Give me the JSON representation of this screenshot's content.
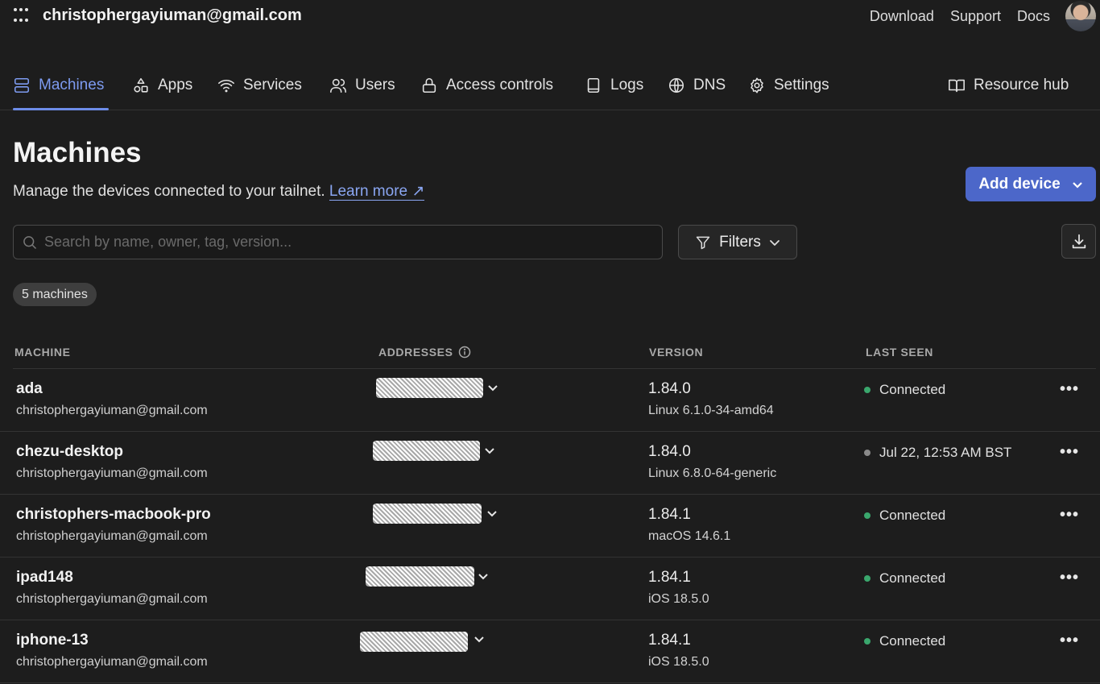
{
  "header": {
    "account": "christophergayiuman@gmail.com",
    "links": [
      "Download",
      "Support",
      "Docs"
    ]
  },
  "nav": {
    "items": [
      {
        "label": "Machines",
        "icon": "server-icon"
      },
      {
        "label": "Apps",
        "icon": "apps-icon"
      },
      {
        "label": "Services",
        "icon": "wifi-icon"
      },
      {
        "label": "Users",
        "icon": "users-icon"
      },
      {
        "label": "Access controls",
        "icon": "lock-icon"
      },
      {
        "label": "Logs",
        "icon": "logs-icon"
      },
      {
        "label": "DNS",
        "icon": "globe-icon"
      },
      {
        "label": "Settings",
        "icon": "gear-icon"
      }
    ],
    "resource_hub": "Resource hub",
    "active": "Machines"
  },
  "page": {
    "title": "Machines",
    "subtitle": "Manage the devices connected to your tailnet.",
    "learn_more": "Learn more ↗",
    "add_device": "Add device",
    "search_placeholder": "Search by name, owner, tag, version...",
    "filters": "Filters",
    "count": "5 machines"
  },
  "table": {
    "headers": {
      "machine": "MACHINE",
      "addresses": "ADDRESSES",
      "version": "VERSION",
      "last_seen": "LAST SEEN"
    },
    "rows": [
      {
        "name": "ada",
        "owner": "christophergayiuman@gmail.com",
        "version": "1.84.0",
        "os": "Linux 6.1.0-34-amd64",
        "last_seen": "Connected",
        "status": "online"
      },
      {
        "name": "chezu-desktop",
        "owner": "christophergayiuman@gmail.com",
        "version": "1.84.0",
        "os": "Linux 6.8.0-64-generic",
        "last_seen": "Jul 22, 12:53 AM BST",
        "status": "offline"
      },
      {
        "name": "christophers-macbook-pro",
        "owner": "christophergayiuman@gmail.com",
        "version": "1.84.1",
        "os": "macOS 14.6.1",
        "last_seen": "Connected",
        "status": "online"
      },
      {
        "name": "ipad148",
        "owner": "christophergayiuman@gmail.com",
        "version": "1.84.1",
        "os": "iOS 18.5.0",
        "last_seen": "Connected",
        "status": "online"
      },
      {
        "name": "iphone-13",
        "owner": "christophergayiuman@gmail.com",
        "version": "1.84.1",
        "os": "iOS 18.5.0",
        "last_seen": "Connected",
        "status": "online"
      }
    ]
  },
  "colors": {
    "accent": "#4c67c9",
    "nav_active": "#7d9bf0",
    "online": "#3aa76d",
    "offline": "#8a8a8a"
  }
}
